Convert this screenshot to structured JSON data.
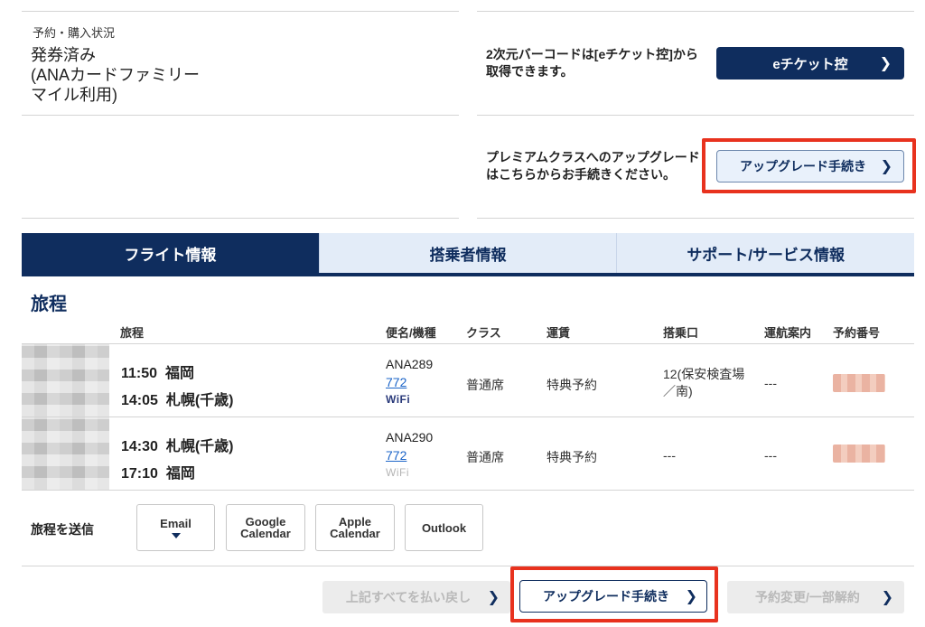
{
  "status": {
    "label": "予約・購入状況",
    "value": "発券済み\n(ANAカードファミリー\nマイル利用)"
  },
  "eticket": {
    "note": "2次元バーコードは[eチケット控]から\n取得できます。",
    "button_label": "eチケット控"
  },
  "upgrade_top": {
    "note": "プレミアムクラスへのアップグレード\nはこちらからお手続きください。",
    "button_label": "アップグレード手続き"
  },
  "tabs": [
    "フライト情報",
    "搭乗者情報",
    "サポート/サービス情報"
  ],
  "itinerary": {
    "title": "旅程",
    "columns": [
      "旅程",
      "便名/機種",
      "クラス",
      "運賃",
      "搭乗口",
      "運航案内",
      "予約番号"
    ],
    "rows": [
      {
        "dep_time": "11:50",
        "dep_city": "福岡",
        "arr_time": "14:05",
        "arr_city": "札幌(千歳)",
        "flight": "ANA289",
        "aircraft": "772",
        "wifi": "WiFi",
        "wifi_available": true,
        "class": "普通席",
        "fare": "特典予約",
        "gate": "12(保安検査場\n／南)",
        "ops": "---"
      },
      {
        "dep_time": "14:30",
        "dep_city": "札幌(千歳)",
        "arr_time": "17:10",
        "arr_city": "福岡",
        "flight": "ANA290",
        "aircraft": "772",
        "wifi": "WiFi",
        "wifi_available": false,
        "class": "普通席",
        "fare": "特典予約",
        "gate": "---",
        "ops": "---"
      }
    ]
  },
  "send": {
    "label": "旅程を送信",
    "buttons": [
      "Email",
      "Google\nCalendar",
      "Apple\nCalendar",
      "Outlook"
    ]
  },
  "bottom": {
    "refund_label": "上記すべてを払い戻し",
    "upgrade_label": "アップグレード手続き",
    "change_label": "予約変更/一部解約"
  },
  "colors": {
    "navy": "#0f2d5e",
    "highlight_red": "#e8321e",
    "link_blue": "#1b64c8"
  }
}
